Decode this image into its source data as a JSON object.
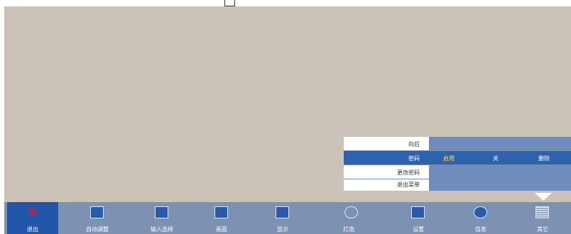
{
  "popup": {
    "rows": [
      {
        "label": "向后",
        "check": "✓"
      },
      {
        "label": "密码",
        "options": [
          "启用",
          "关",
          "删除"
        ],
        "selected_option": "启用"
      },
      {
        "label": "更改密码",
        "check": "✓"
      },
      {
        "label": "退出菜单",
        "check": "✓"
      }
    ]
  },
  "toolbar": {
    "items": [
      {
        "label": "退出",
        "icon": "close-icon"
      },
      {
        "label": "自动调整",
        "icon": "auto-adjust-icon"
      },
      {
        "label": "输入选择",
        "icon": "input-select-icon"
      },
      {
        "label": "画面",
        "icon": "picture-icon"
      },
      {
        "label": "显示",
        "icon": "display-icon"
      },
      {
        "label": "灯泡",
        "icon": "lamp-icon"
      },
      {
        "label": "设置",
        "icon": "settings-icon"
      },
      {
        "label": "信息",
        "icon": "info-globe-icon"
      },
      {
        "label": "其它",
        "icon": "other-icon"
      }
    ]
  },
  "colors": {
    "background": "#cbc3b9",
    "toolbar": "#7d91b3",
    "active": "#2256a8",
    "highlight": "#ffe14a"
  }
}
